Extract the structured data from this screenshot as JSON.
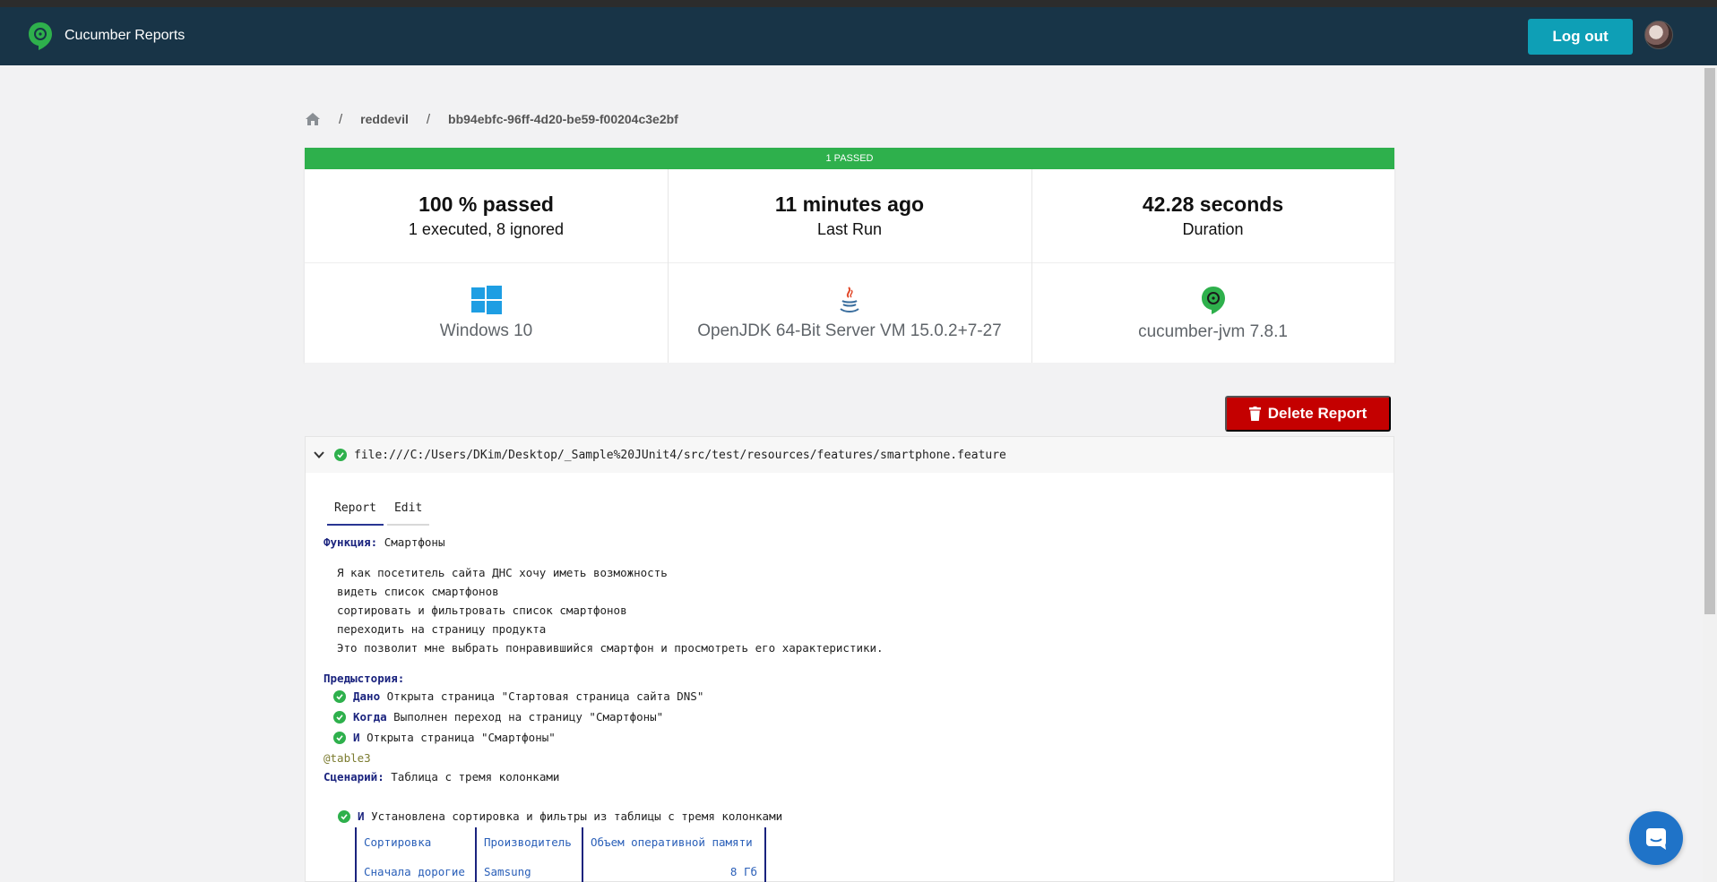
{
  "app": {
    "title": "Cucumber Reports",
    "logout_label": "Log out"
  },
  "breadcrumb": {
    "user": "reddevil",
    "report_id": "bb94ebfc-96ff-4d20-be59-f00204c3e2bf",
    "separator": "/"
  },
  "summary": {
    "status_bar": "1 PASSED",
    "passed_pct": "100 % passed",
    "executed": "1 executed, 8 ignored",
    "last_run_value": "11 minutes ago",
    "last_run_label": "Last Run",
    "duration_value": "42.28 seconds",
    "duration_label": "Duration",
    "os": "Windows 10",
    "jvm": "OpenJDK 64-Bit Server VM 15.0.2+7-27",
    "cucumber": "cucumber-jvm 7.8.1"
  },
  "actions": {
    "delete_label": "Delete Report"
  },
  "feature": {
    "uri": "file:///C:/Users/DKim/Desktop/_Sample%20JUnit4/src/test/resources/features/smartphone.feature",
    "tabs": [
      "Report",
      "Edit"
    ],
    "keyword": "Функция:",
    "name": "Смартфоны",
    "description": [
      "Я как посетитель сайта ДНС хочу иметь возможность",
      "видеть список смартфонов",
      "сортировать и фильтровать список смартфонов",
      "переходить на страницу продукта",
      "Это позволит мне выбрать понравившийся смартфон и просмотреть его характеристики."
    ],
    "background_keyword": "Предыстория:",
    "background_steps": [
      {
        "keyword": "Дано",
        "text": "Открыта страница \"Стартовая страница сайта DNS\""
      },
      {
        "keyword": "Когда",
        "text": "Выполнен переход на страницу \"Смартфоны\""
      },
      {
        "keyword": "И",
        "text": "Открыта страница \"Смартфоны\""
      }
    ],
    "tag": "@table3",
    "scenario_keyword": "Сценарий:",
    "scenario_name": "Таблица с тремя колонками",
    "scenario_step": {
      "keyword": "И",
      "text": "Установлена сортировка и фильтры из таблицы с тремя колонками"
    },
    "table": [
      [
        "Сортировка",
        "Производитель",
        "Объем оперативной памяти"
      ],
      [
        "Сначала дорогие",
        "Samsung",
        "8 Гб"
      ]
    ]
  },
  "colors": {
    "navbar": "#183447",
    "passed": "#2eb04c",
    "logout": "#0e9fb6",
    "delete": "#c40000",
    "keyword": "#1a237e"
  }
}
